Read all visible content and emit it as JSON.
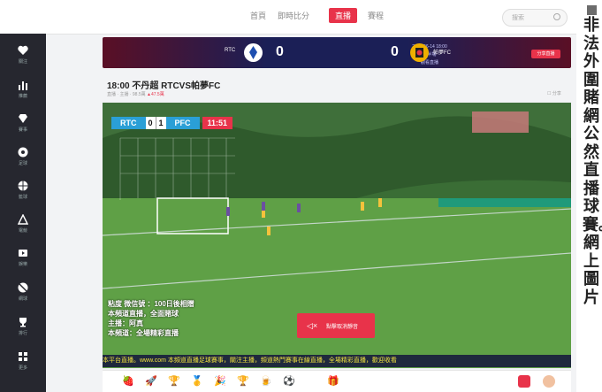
{
  "nav": {
    "items": [
      "首頁",
      "即時比分",
      "直播",
      "賽程"
    ],
    "active_index": 2
  },
  "search": {
    "placeholder": "搜索"
  },
  "sidebar": {
    "items": [
      {
        "label": "關注",
        "icon": "heart-icon"
      },
      {
        "label": "推薦",
        "icon": "chart-icon"
      },
      {
        "label": "賽事",
        "icon": "diamond-icon"
      },
      {
        "label": "足球",
        "icon": "soccer-ball-icon"
      },
      {
        "label": "籃球",
        "icon": "basketball-icon"
      },
      {
        "label": "電競",
        "icon": "triangle-icon"
      },
      {
        "label": "娛樂",
        "icon": "video-icon"
      },
      {
        "label": "網球",
        "icon": "tennis-icon"
      },
      {
        "label": "排行",
        "icon": "trophy-icon"
      },
      {
        "label": "更多",
        "icon": "grid-icon"
      }
    ]
  },
  "scoreboard": {
    "home": "RTC",
    "away": "帕夢FC",
    "home_score": "0",
    "away_score": "0",
    "date": "2020-06-14 18:00",
    "status": "上半場",
    "meta": "觀看直播",
    "button": "分享直播"
  },
  "match": {
    "title": "18:00 不丹超 RTCVS帕夢FC",
    "meta": "直播 · 主播 · 98.5萬",
    "hot": "47.5萬",
    "share": "分享"
  },
  "video": {
    "scorebug": {
      "home": "RTC",
      "home_score": "0",
      "away_score": "1",
      "away": "PFC",
      "clock": "11:51"
    },
    "info_lines": [
      "粘度 微信號 ：100日後相贈",
      "本頻道直播，全面賭球",
      "主播：阿真",
      "本頻道：全場精彩直播"
    ],
    "play_label": "點擊取消靜音",
    "marquee": "本平台直播。www.com 本頻道直播足球賽事，關注主播，頻道熱門賽事在線直播，全場精彩直播，歡迎收看"
  },
  "gifts": [
    "🍓",
    "🚀",
    "🏆",
    "🥇",
    "🎉",
    "🏆",
    "🍺",
    "⚽",
    "🎁"
  ],
  "caption": {
    "text": "非法外圍賭網公然直播球賽。網上圖片"
  },
  "colors": {
    "accent": "#e8334a",
    "sidebar": "#26272f",
    "pitch": "#4f8a3a"
  }
}
